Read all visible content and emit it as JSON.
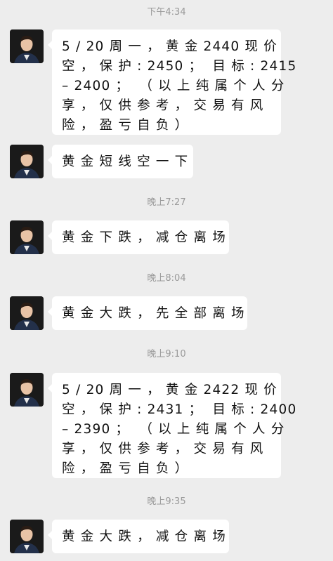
{
  "messages": [
    {
      "time": "下午4:34",
      "text": "5 / 20 周 一 ， 黄 金 2440 现 价\n空 ， 保 护 : 2450 ；  目 标 : 2415\n– 2400 ；  （ 以 上 纯 属 个 人 分\n享 ， 仅 供 参 考 ， 交 易 有 风\n险 ， 盈 亏 自 负 ）"
    },
    {
      "time": "",
      "text": "黄 金 短 线 空 一 下"
    },
    {
      "time": "晚上7:27",
      "text": "黄 金 下 跌 ， 减 仓 离 场"
    },
    {
      "time": "晚上8:04",
      "text": "黄 金 大 跌 ， 先 全 部 离 场"
    },
    {
      "time": "晚上9:10",
      "text": "5 / 20 周 一 ， 黄 金 2422 现 价\n空 ， 保 护 : 2431 ；  目 标 : 2400\n– 2390 ；  （ 以 上 纯 属 个 人 分\n享 ， 仅 供 参 考 ， 交 易 有 风\n险 ， 盈 亏 自 负 ）"
    },
    {
      "time": "晚上9:35",
      "text": "黄 金 大 跌 ， 减 仓 离 场"
    }
  ]
}
